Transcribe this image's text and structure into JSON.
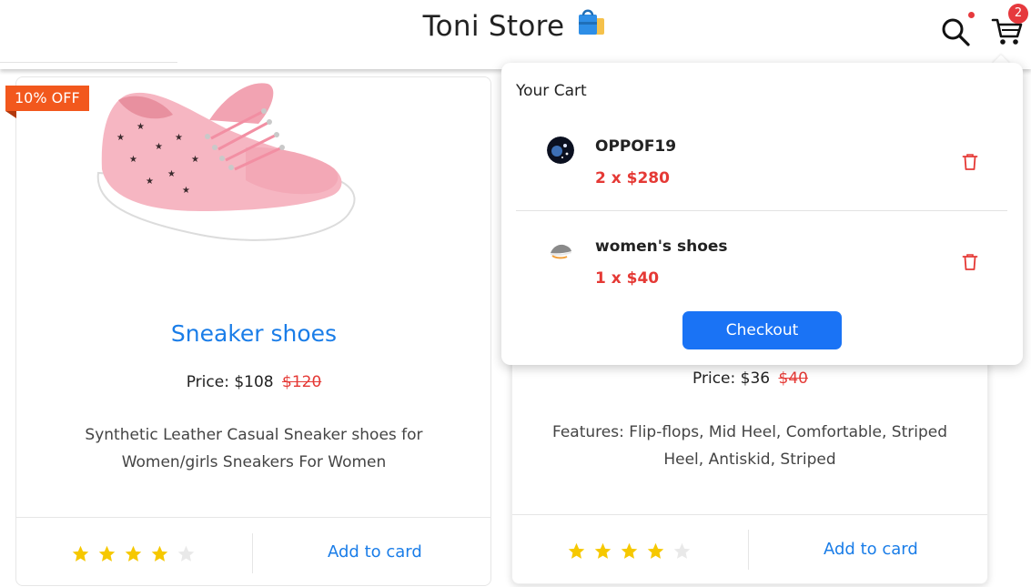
{
  "header": {
    "brand": "Toni Store",
    "cart_count": "2",
    "accent_color": "#1a7de8",
    "badge_color": "#e6393d"
  },
  "products": [
    {
      "badge": "10% OFF",
      "title": "Sneaker shoes",
      "price_label": "Price: $108",
      "old_price": "$120",
      "description": "Synthetic Leather Casual Sneaker shoes for Women/girls Sneakers For Women",
      "rating": 4,
      "rating_max": 5,
      "action": "Add to card"
    },
    {
      "price_label": "Price: $36",
      "old_price": "$40",
      "description": "Features: Flip-flops, Mid Heel, Comfortable, Striped Heel, Antiskid, Striped",
      "rating": 4,
      "rating_max": 5,
      "action": "Add to card"
    }
  ],
  "cart": {
    "heading": "Your Cart",
    "items": [
      {
        "name": "OPPOF19",
        "qty_price": "2 x $280",
        "icon": "trash-icon"
      },
      {
        "name": "women's shoes",
        "qty_price": "1 x $40",
        "icon": "trash-icon"
      }
    ],
    "checkout_label": "Checkout"
  }
}
